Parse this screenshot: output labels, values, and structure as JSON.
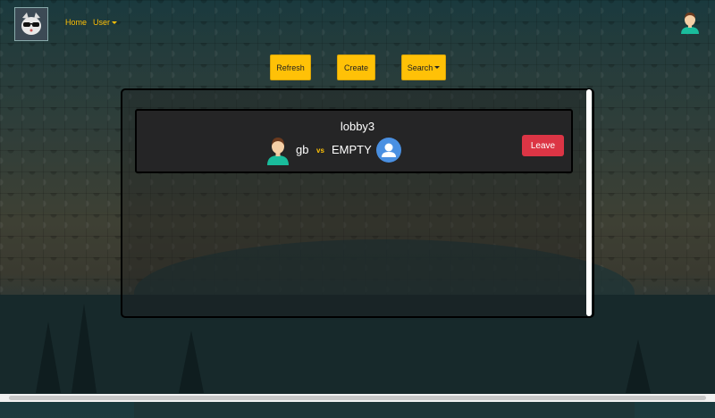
{
  "nav": {
    "links": [
      {
        "label": "Home"
      },
      {
        "label": "User"
      }
    ],
    "logo_icon": "cat-sunglasses-logo",
    "avatar_icon": "user-avatar-icon"
  },
  "toolbar": {
    "refresh_label": "Refresh",
    "create_label": "Create",
    "search_label": "Search"
  },
  "lobby": {
    "name": "lobby3",
    "player1": "gb",
    "vs": "vs",
    "player2": "EMPTY",
    "leave_label": "Leave"
  },
  "colors": {
    "accent": "#ffc107",
    "danger": "#dc3545",
    "card_bg": "#252526"
  }
}
